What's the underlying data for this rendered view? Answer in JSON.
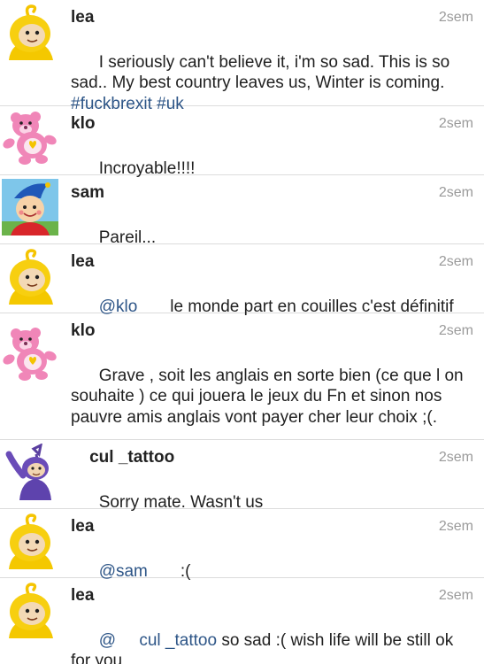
{
  "comments": [
    {
      "username": "lea",
      "time": "2sem",
      "avatar": "laa-laa-avatar",
      "segments": [
        {
          "t": "text",
          "v": "I seriously can't believe it, i'm so sad. This is so sad.. My best country leaves us, Winter is coming. "
        },
        {
          "t": "link",
          "v": "#fuckbrexit"
        },
        {
          "t": "text",
          "v": " "
        },
        {
          "t": "link",
          "v": "#uk"
        }
      ]
    },
    {
      "username": "klo",
      "time": "2sem",
      "avatar": "care-bear-avatar",
      "segments": [
        {
          "t": "text",
          "v": "Incroyable!!!!"
        }
      ]
    },
    {
      "username": "sam",
      "time": "2sem",
      "avatar": "noddy-avatar",
      "segments": [
        {
          "t": "text",
          "v": "Pareil..."
        }
      ]
    },
    {
      "username": "lea",
      "time": "2sem",
      "avatar": "laa-laa-avatar",
      "segments": [
        {
          "t": "link",
          "v": "@klo"
        },
        {
          "t": "text",
          "v": "       le monde part en couilles c'est définitif"
        }
      ]
    },
    {
      "username": "klo",
      "time": "2sem",
      "avatar": "care-bear-avatar",
      "segments": [
        {
          "t": "text",
          "v": "Grave , soit les anglais en sorte bien (ce que l on souhaite ) ce qui jouera le jeux du Fn et sinon nos pauvre amis anglais vont payer cher leur choix ;(."
        }
      ]
    },
    {
      "username": "    cul _tattoo",
      "time": "2sem",
      "avatar": "tinky-winky-avatar",
      "segments": [
        {
          "t": "text",
          "v": "Sorry mate. Wasn't us"
        }
      ]
    },
    {
      "username": "lea",
      "time": "2sem",
      "avatar": "laa-laa-avatar",
      "segments": [
        {
          "t": "link",
          "v": "@sam"
        },
        {
          "t": "text",
          "v": "       :("
        }
      ]
    },
    {
      "username": "lea",
      "time": "2sem",
      "avatar": "laa-laa-avatar",
      "segments": [
        {
          "t": "link",
          "v": "@     cul _tattoo"
        },
        {
          "t": "text",
          "v": " so sad :( wish life will be still ok for you"
        }
      ]
    }
  ]
}
